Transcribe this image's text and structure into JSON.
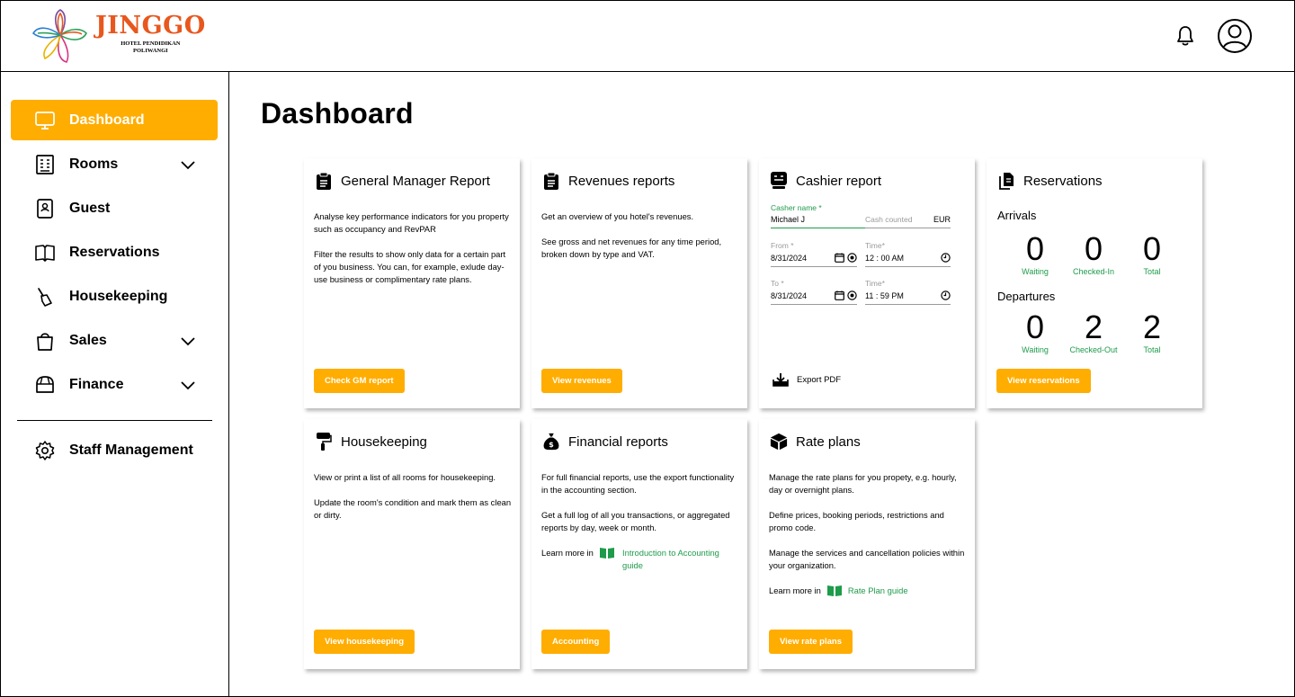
{
  "brand": {
    "name": "JINGGO",
    "sub_line1": "HOTEL PENDIDIKAN",
    "sub_line2": "POLIWANGI"
  },
  "header": {
    "icons": [
      "bell-icon",
      "user-avatar-icon"
    ]
  },
  "sidebar": {
    "items": [
      {
        "label": "Dashboard",
        "icon": "monitor-icon",
        "active": true
      },
      {
        "label": "Rooms",
        "icon": "building-icon",
        "expandable": true
      },
      {
        "label": "Guest",
        "icon": "guest-book-icon"
      },
      {
        "label": "Reservations",
        "icon": "open-book-icon"
      },
      {
        "label": "Housekeeping",
        "icon": "broom-icon"
      },
      {
        "label": "Sales",
        "icon": "shopping-bag-icon",
        "expandable": true
      },
      {
        "label": "Finance",
        "icon": "wallet-icon",
        "expandable": true
      }
    ],
    "staff": {
      "label": "Staff Management",
      "icon": "gear-icon"
    }
  },
  "page": {
    "title": "Dashboard"
  },
  "colors": {
    "accent": "#ffad00",
    "green": "#1e9b4b",
    "logo": "#e8571e"
  },
  "cards": {
    "gm": {
      "title": "General Manager Report",
      "p1": "Analyse key performance indicators for you property such as occupancy and RevPAR",
      "p2": "Filter the results to show only data for a certain part of you business. You can, for example, exlude day-use business or complimentary rate plans.",
      "button": "Check GM report"
    },
    "revenues": {
      "title": "Revenues reports",
      "p1": "Get an overview of you hotel's revenues.",
      "p2": "See gross and net revenues for any time period, broken down by type and VAT.",
      "button": "View revenues"
    },
    "cashier": {
      "title": "Cashier report",
      "casher_label": "Casher name *",
      "casher_value": "Michael J",
      "cash_label": "Cash counted",
      "currency": "EUR",
      "from_label": "From *",
      "from_value": "8/31/2024",
      "time1_label": "Time*",
      "time1_value": "12 : 00 AM",
      "to_label": "To *",
      "to_value": "8/31/2024",
      "time2_label": "Time*",
      "time2_value": "11 : 59 PM",
      "export": "Export PDF"
    },
    "reservations": {
      "title": "Reservations",
      "arrivals_label": "Arrivals",
      "arrivals": [
        {
          "value": "0",
          "label": "Waiting"
        },
        {
          "value": "0",
          "label": "Checked-In"
        },
        {
          "value": "0",
          "label": "Total"
        }
      ],
      "departures_label": "Departures",
      "departures": [
        {
          "value": "0",
          "label": "Waiting"
        },
        {
          "value": "2",
          "label": "Checked-Out"
        },
        {
          "value": "2",
          "label": "Total"
        }
      ],
      "button": "View reservations"
    },
    "housekeeping": {
      "title": "Housekeeping",
      "p1": "View or print a list of all rooms for housekeeping.",
      "p2": "Update the room's condition and mark them as clean or dirty.",
      "button": "View housekeeping"
    },
    "financial": {
      "title": "Financial reports",
      "p1": "For full financial reports, use the export functionality in the accounting section.",
      "p2": "Get a full log of all you transactions, or aggregated reports by day, week or month.",
      "learn": "Learn more in",
      "link": "Introduction to Accounting guide",
      "button": "Accounting"
    },
    "rateplans": {
      "title": "Rate plans",
      "p1": "Manage the rate plans for you propety, e.g. hourly, day or overnight plans.",
      "p2": "Define prices, booking periods, restrictions and promo code.",
      "p3": "Manage the services and cancellation policies within your organization.",
      "learn": "Learn more in",
      "link": "Rate Plan guide",
      "button": "View rate plans"
    }
  }
}
